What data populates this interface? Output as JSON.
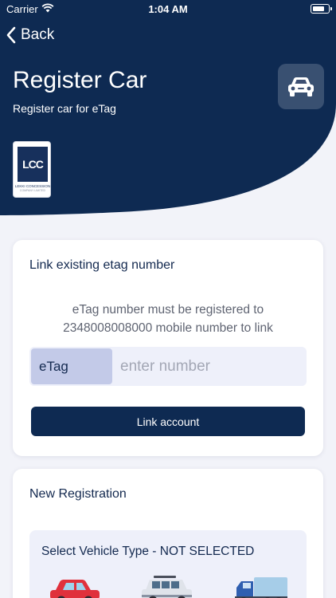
{
  "status_bar": {
    "carrier": "Carrier",
    "time": "1:04 AM"
  },
  "nav": {
    "back_label": "Back"
  },
  "header": {
    "title": "Register Car",
    "subtitle": "Register car for eTag",
    "car_icon": "car-icon",
    "logo": {
      "text": "LCC",
      "name": "LEKKI CONCESSION",
      "tagline": "COMPANY LIMITED"
    }
  },
  "link_card": {
    "title": "Link existing etag number",
    "info_line1": "eTag number must be registered to",
    "info_line2": "2348008008000 mobile number to link",
    "etag_label": "eTag",
    "etag_placeholder": "enter number",
    "etag_value": "",
    "link_button": "Link account"
  },
  "registration_card": {
    "title": "New Registration",
    "vehicle_type_title": "Select Vehicle Type - NOT SELECTED",
    "vehicle_options": [
      "car-icon",
      "suv-icon",
      "truck-icon"
    ]
  },
  "colors": {
    "primary_navy": "#0e2a52",
    "page_bg": "#f2f3f9",
    "etag_label_bg": "#c3cae8",
    "logo_accent": "#e8782a"
  }
}
